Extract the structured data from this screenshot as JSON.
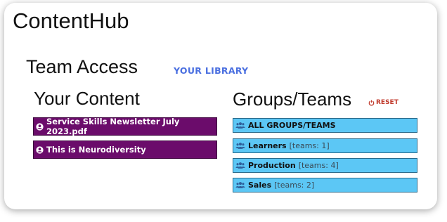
{
  "app": {
    "title": "ContentHub"
  },
  "page": {
    "title": "Team Access",
    "library_link": "YOUR LIBRARY"
  },
  "content": {
    "title": "Your Content",
    "items": [
      {
        "label": "Service Skills Newsletter July 2023.pdf"
      },
      {
        "label": "This is Neurodiversity"
      }
    ]
  },
  "groups": {
    "title": "Groups/Teams",
    "reset_label": "RESET",
    "items": [
      {
        "label": "ALL GROUPS/TEAMS",
        "teams": ""
      },
      {
        "label": "Learners",
        "teams": "[teams: 1]"
      },
      {
        "label": "Production",
        "teams": "[teams: 4]"
      },
      {
        "label": "Sales",
        "teams": "[teams: 2]"
      }
    ]
  },
  "colors": {
    "content_bg": "#6b0c6b",
    "group_bg": "#5cc7f5",
    "link": "#4a6fe0",
    "reset": "#c0392b"
  },
  "icons": {
    "content_item": "user-circle-icon",
    "group_item": "users-icon",
    "reset": "power-icon"
  }
}
